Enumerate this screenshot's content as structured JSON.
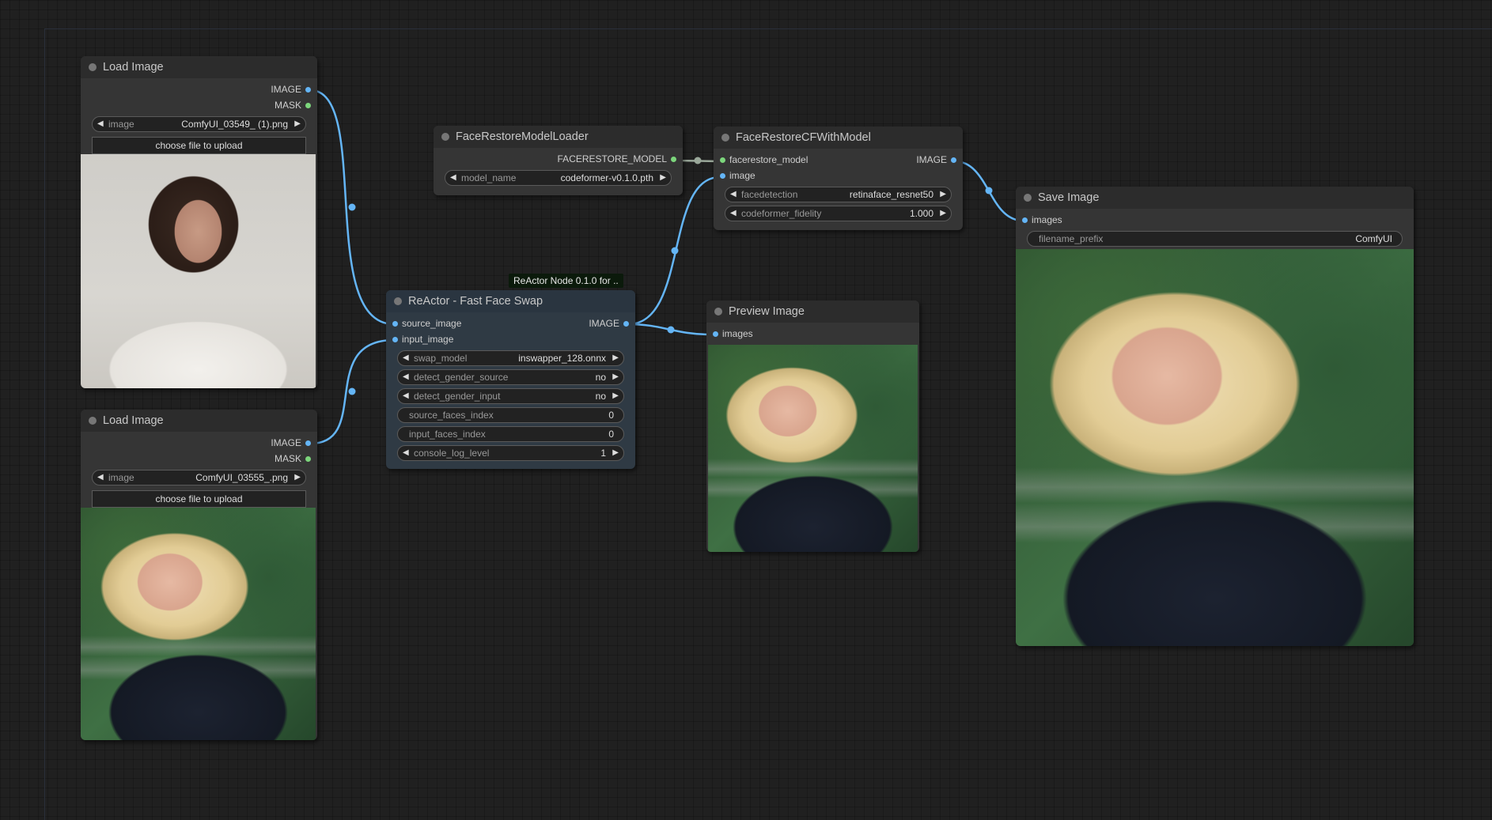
{
  "nodes": {
    "load_image_1": {
      "title": "Load Image",
      "outputs": [
        "IMAGE",
        "MASK"
      ],
      "image_label": "image",
      "image_value": "ComfyUI_03549_ (1).png",
      "upload_label": "choose file to upload"
    },
    "load_image_2": {
      "title": "Load Image",
      "outputs": [
        "IMAGE",
        "MASK"
      ],
      "image_label": "image",
      "image_value": "ComfyUI_03555_.png",
      "upload_label": "choose file to upload"
    },
    "face_restore_loader": {
      "title": "FaceRestoreModelLoader",
      "output": "FACERESTORE_MODEL",
      "model_label": "model_name",
      "model_value": "codeformer-v0.1.0.pth"
    },
    "face_restore_cf": {
      "title": "FaceRestoreCFWithModel",
      "inputs": [
        "facerestore_model",
        "image"
      ],
      "output": "IMAGE",
      "facedetection_label": "facedetection",
      "facedetection_value": "retinaface_resnet50",
      "fidelity_label": "codeformer_fidelity",
      "fidelity_value": "1.000"
    },
    "reactor": {
      "badge": "ReActor Node 0.1.0 for ..",
      "title": "ReActor - Fast Face Swap",
      "inputs": [
        "source_image",
        "input_image"
      ],
      "output": "IMAGE",
      "widgets": [
        {
          "label": "swap_model",
          "value": "inswapper_128.onnx"
        },
        {
          "label": "detect_gender_source",
          "value": "no"
        },
        {
          "label": "detect_gender_input",
          "value": "no"
        },
        {
          "label": "source_faces_index",
          "value": "0"
        },
        {
          "label": "input_faces_index",
          "value": "0"
        },
        {
          "label": "console_log_level",
          "value": "1"
        }
      ]
    },
    "preview_image": {
      "title": "Preview Image",
      "input": "images"
    },
    "save_image": {
      "title": "Save Image",
      "input": "images",
      "prefix_label": "filename_prefix",
      "prefix_value": "ComfyUI"
    }
  },
  "colors": {
    "link_image": "#64b5f6",
    "link_model": "#9aa89a",
    "slot_image": "#64b5f6",
    "slot_mask": "#7cd67c",
    "node_bg": "#353535",
    "canvas_bg": "#202020"
  }
}
